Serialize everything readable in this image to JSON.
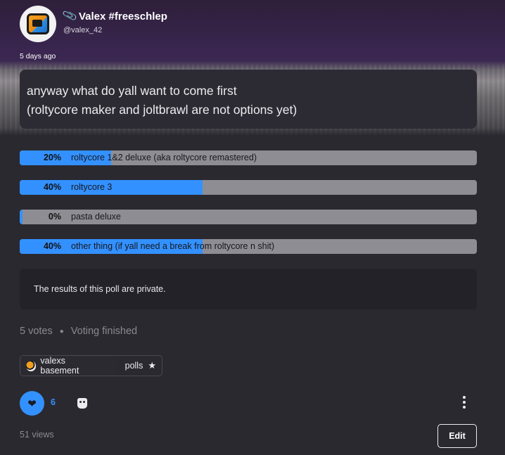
{
  "author": {
    "display_name": "Valex #freeschlep",
    "handle": "@valex_42",
    "badge_icon": "paperclip-icon"
  },
  "post": {
    "timestamp": "5 days ago",
    "text_line1": "anyway what do yall want to come first",
    "text_line2": "(roltycore maker and joltbrawl are not options yet)"
  },
  "poll": {
    "options": [
      {
        "percent": "20%",
        "fraction": 0.2,
        "label": "roltycore 1&2 deluxe (aka roltycore remastered)"
      },
      {
        "percent": "40%",
        "fraction": 0.4,
        "label": "roltycore 3"
      },
      {
        "percent": "0%",
        "fraction": 0.0,
        "label": "pasta deluxe"
      },
      {
        "percent": "40%",
        "fraction": 0.4,
        "label": "other thing (if yall need a break from roltycore n shit)"
      }
    ],
    "private_notice": "The results of this poll are private.",
    "votes": "5 votes",
    "status": "Voting finished"
  },
  "tags": [
    {
      "label": "valexs basement"
    },
    {
      "label": "polls"
    }
  ],
  "actions": {
    "like_count": "6",
    "views": "51 views",
    "edit_label": "Edit"
  },
  "colors": {
    "accent": "#3391ff",
    "bar_background": "#8e8d94",
    "page_background": "#2a2930"
  }
}
